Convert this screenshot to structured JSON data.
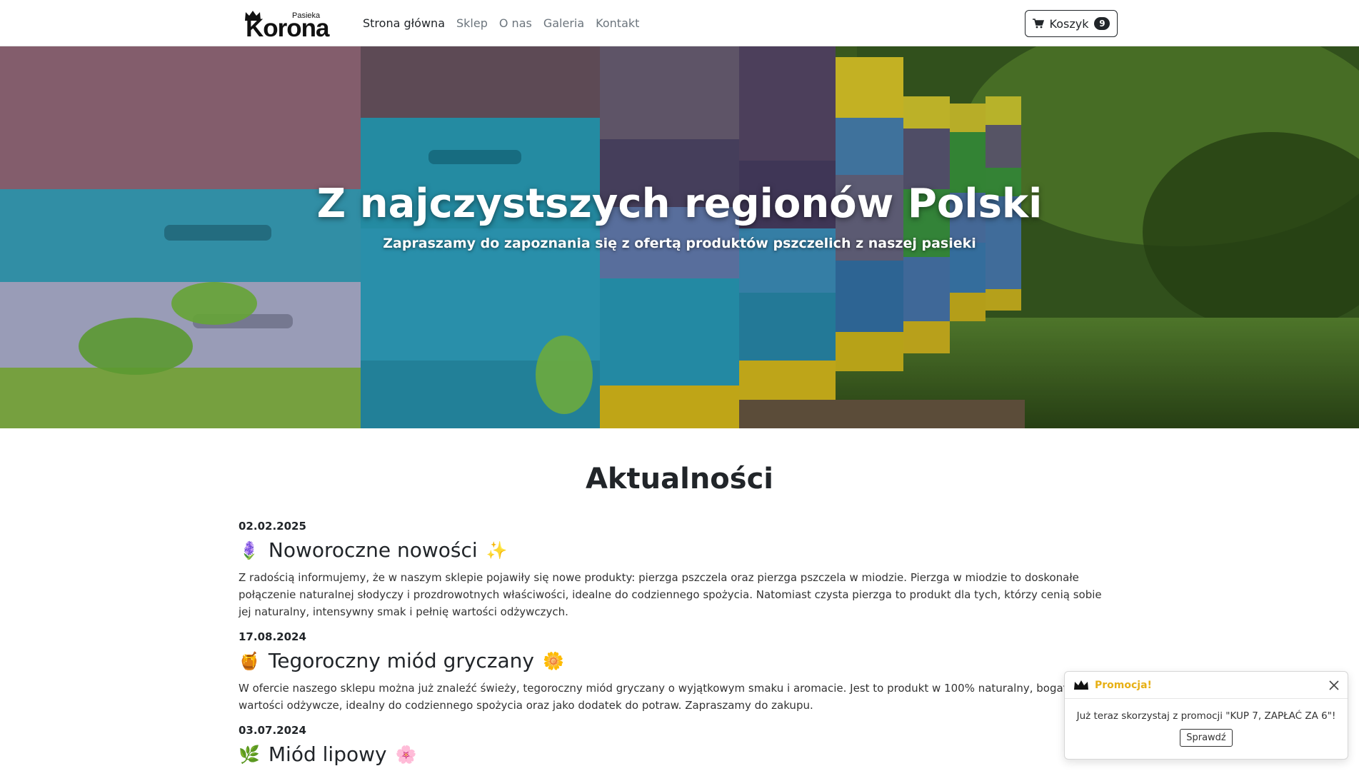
{
  "brand": {
    "small": "Pasieka",
    "big": "Korona"
  },
  "nav": {
    "links": [
      {
        "label": "Strona główna",
        "active": true
      },
      {
        "label": "Sklep",
        "active": false
      },
      {
        "label": "O nas",
        "active": false
      },
      {
        "label": "Galeria",
        "active": false
      },
      {
        "label": "Kontakt",
        "active": false
      }
    ],
    "cart": {
      "label": "Koszyk",
      "count": "9",
      "icon": "cart-icon"
    }
  },
  "hero": {
    "title": "Z najczystszych regionów Polski",
    "subtitle": "Zapraszamy do zapoznania się z ofertą produktów pszczelich z naszej pasieki"
  },
  "news": {
    "heading": "Aktualności",
    "items": [
      {
        "date": "02.02.2025",
        "emoji_left": "🪻",
        "title": "Noworoczne nowości",
        "emoji_right": "✨",
        "text": "Z radością informujemy, że w naszym sklepie pojawiły się nowe produkty: pierzga pszczela oraz pierzga pszczela w miodzie. Pierzga w miodzie to doskonałe połączenie naturalnej słodyczy i prozdrowotnych właściwości, idealne do codziennego spożycia. Natomiast czysta pierzga to produkt dla tych, którzy cenią sobie jej naturalny, intensywny smak i pełnię wartości odżywczych."
      },
      {
        "date": "17.08.2024",
        "emoji_left": "🍯",
        "title": "Tegoroczny miód gryczany",
        "emoji_right": "🌼",
        "text": "W ofercie naszego sklepu można już znaleźć świeży, tegoroczny miód gryczany o wyjątkowym smaku i aromacie. Jest to produkt w 100% naturalny, bogaty w wartości odżywcze, idealny do codziennego spożycia oraz jako dodatek do potraw. Zapraszamy do zakupu."
      },
      {
        "date": "03.07.2024",
        "emoji_left": "🌿",
        "title": "Miód lipowy",
        "emoji_right": "🌸",
        "text": ""
      }
    ]
  },
  "toast": {
    "title": "Promocja!",
    "message": "Już teraz skorzystaj z promocji \"KUP 7, ZAPŁAĆ ZA 6\"!",
    "button": "Sprawdź",
    "title_color": "#e7b015"
  }
}
